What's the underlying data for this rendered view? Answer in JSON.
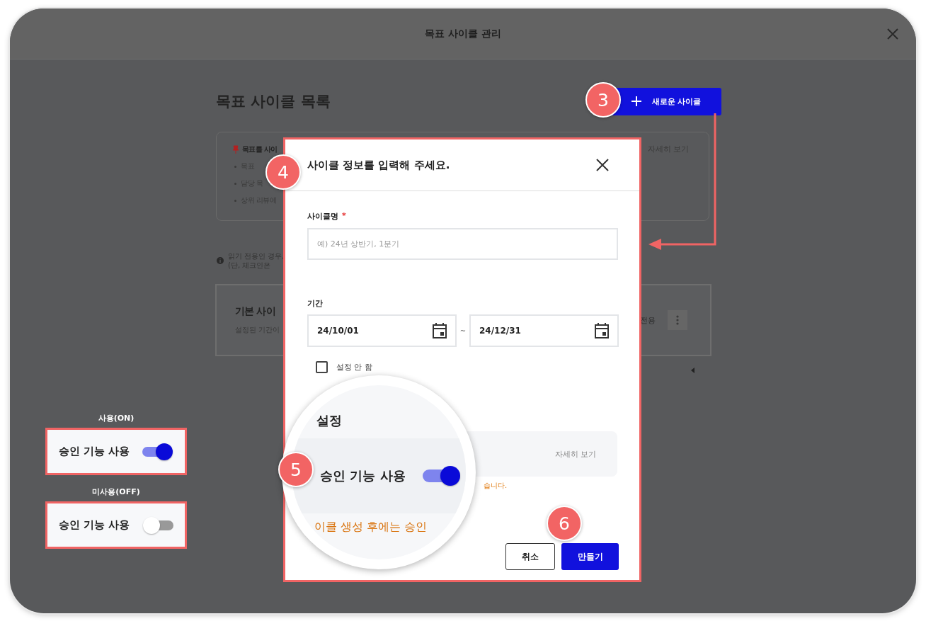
{
  "window": {
    "title": "목표 사이클 관리"
  },
  "page": {
    "heading": "목표 사이클 목록",
    "new_button": "새로운 사이클",
    "info_card": {
      "title": "목표를 사이",
      "items": [
        "목표",
        "담당 목",
        "상위 리뷰에"
      ],
      "link": "자세히 보기"
    },
    "notice": [
      "읽기 전용인 경우,",
      "(단, 체크인은"
    ],
    "cycle_card": {
      "title": "기본 사이",
      "subtitle": "설정된 기간이",
      "badge": "전용"
    }
  },
  "dialog": {
    "title": "사이클 정보를 입력해 주세요.",
    "name_label": "사이클명",
    "required_mark": "*",
    "name_placeholder": "예) 24년 상반기, 1분기",
    "period_label": "기간",
    "start": "24/10/01",
    "separator": "~",
    "end": "24/12/31",
    "no_period": {
      "label": "설정 안 함",
      "checked": false
    },
    "settings_link": "자세히 보기",
    "note": "습니다.",
    "buttons": [
      {
        "label": "취소",
        "kind": "secondary"
      },
      {
        "label": "만들기",
        "kind": "primary"
      }
    ]
  },
  "magnifier": {
    "heading": "설정",
    "toggle_label": "승인 기능 사용",
    "on": true,
    "note": "이클 생성 후에는 승인"
  },
  "examples": [
    {
      "caption": "사용(ON)",
      "label": "승인 기능 사용",
      "on": true
    },
    {
      "caption": "미사용(OFF)",
      "label": "승인 기능 사용",
      "on": false
    }
  ],
  "callouts": [
    "3",
    "4",
    "5",
    "6"
  ]
}
